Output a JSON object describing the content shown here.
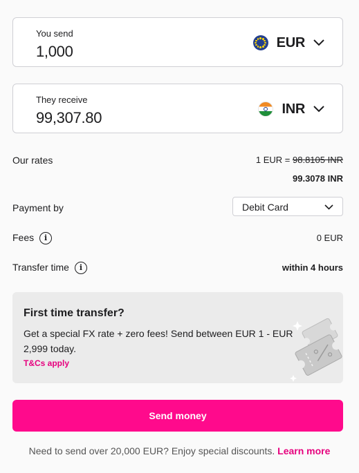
{
  "send": {
    "label": "You send",
    "amount": "1,000",
    "currency": "EUR",
    "flag_icon": "eu-flag-icon"
  },
  "receive": {
    "label": "They receive",
    "amount": "99,307.80",
    "currency": "INR",
    "flag_icon": "india-flag-icon"
  },
  "rates": {
    "label": "Our rates",
    "rate_prefix": "1 EUR =",
    "old_rate": "98.8105 INR",
    "new_rate": "99.3078 INR"
  },
  "payment": {
    "label": "Payment by",
    "selected": "Debit Card"
  },
  "fees": {
    "label": "Fees",
    "value": "0 EUR"
  },
  "transfer_time": {
    "label": "Transfer time",
    "value": "within 4 hours"
  },
  "promo": {
    "title": "First time transfer?",
    "body": "Get a special FX rate + zero fees! Send between EUR 1 - EUR 2,999 today.",
    "terms": "T&Cs apply"
  },
  "cta": {
    "label": "Send money"
  },
  "footer": {
    "text": "Need to send over 20,000 EUR? Enjoy special discounts.",
    "link": "Learn more"
  },
  "colors": {
    "accent": "#ff0a8c",
    "link": "#e6007e",
    "promo_bg": "#ebebeb"
  }
}
